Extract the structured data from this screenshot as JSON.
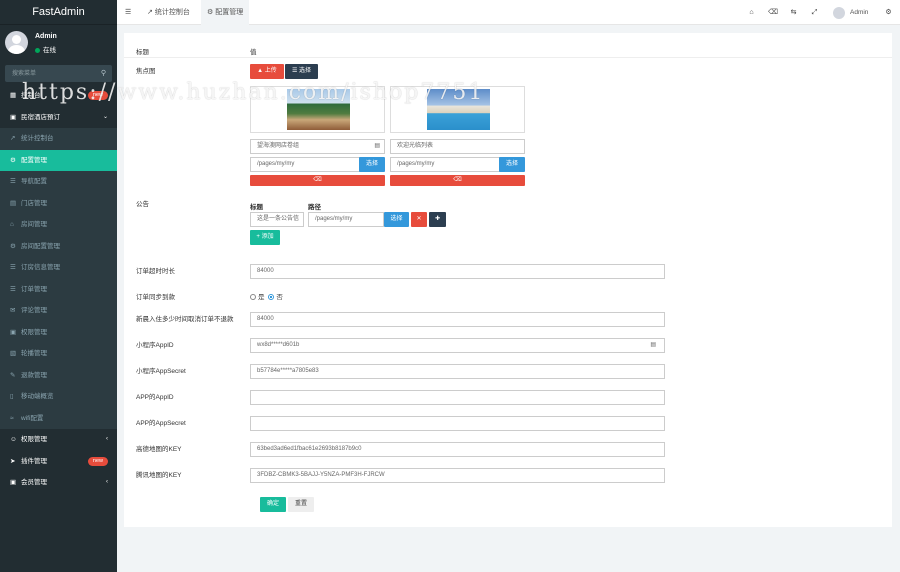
{
  "app": {
    "logo": "FastAdmin"
  },
  "user": {
    "name": "Admin",
    "status": "在线"
  },
  "sidebar": {
    "search_placeholder": "搜索菜单",
    "items": [
      {
        "label": "控制台",
        "icon": "dashboard-icon",
        "type": "top",
        "badge": "new"
      },
      {
        "label": "民宿酒店預订",
        "icon": "hotel-icon",
        "type": "top",
        "arrow": "open"
      },
      {
        "label": "统计控制台",
        "icon": "chart-icon",
        "type": "sub"
      },
      {
        "label": "配置管理",
        "icon": "gear-icon",
        "type": "sub",
        "active": true
      },
      {
        "label": "导航配置",
        "icon": "nav-icon",
        "type": "sub"
      },
      {
        "label": "门店管理",
        "icon": "store-icon",
        "type": "sub"
      },
      {
        "label": "房间管理",
        "icon": "home-icon",
        "type": "sub"
      },
      {
        "label": "房间配置管理",
        "icon": "settings-icon",
        "type": "sub"
      },
      {
        "label": "订房信息管理",
        "icon": "list-icon",
        "type": "sub"
      },
      {
        "label": "订单管理",
        "icon": "order-icon",
        "type": "sub"
      },
      {
        "label": "评论管理",
        "icon": "comment-icon",
        "type": "sub"
      },
      {
        "label": "权限管理",
        "icon": "lock-icon",
        "type": "sub"
      },
      {
        "label": "轮播管理",
        "icon": "image-icon",
        "type": "sub"
      },
      {
        "label": "退款管理",
        "icon": "refund-icon",
        "type": "sub"
      },
      {
        "label": "移动端概览",
        "icon": "mobile-icon",
        "type": "sub"
      },
      {
        "label": "wifi配置",
        "icon": "wifi-icon",
        "type": "sub"
      },
      {
        "label": "权限管理",
        "icon": "users-icon",
        "type": "top",
        "arrow": "closed"
      },
      {
        "label": "插件管理",
        "icon": "rocket-icon",
        "type": "top",
        "badge": "new"
      },
      {
        "label": "会员管理",
        "icon": "member-icon",
        "type": "top",
        "arrow": "closed"
      }
    ]
  },
  "header": {
    "menu_icon": "☰",
    "tabs": [
      {
        "label": "统计控制台",
        "icon": "chart-icon"
      },
      {
        "label": "配置管理",
        "icon": "gear-icon",
        "active": true
      }
    ],
    "user": "Admin"
  },
  "form": {
    "col_title": "标题",
    "col_value": "值",
    "focus_label": "焦点图",
    "upload_label": "上传",
    "choose_label": "选择",
    "slides": [
      {
        "title": "望海澳网店卷组",
        "path": "/pages/my/my",
        "choose": "选择"
      },
      {
        "title": "欢迎光临列表",
        "path": "/pages/my/my",
        "choose": "选择"
      }
    ],
    "notice_label": "公告",
    "notice_head_title": "标题",
    "notice_head_path": "路径",
    "notice_row": {
      "title": "这是一条公告信",
      "path": "/pages/my/my",
      "choose": "选择"
    },
    "add_label": "添加",
    "fields": [
      {
        "label": "订单超时时长",
        "value": "84000"
      },
      {
        "label": "订单同步到款",
        "radio": true,
        "yes": "是",
        "no": "否"
      },
      {
        "label": "新晨入住多少时间取消订单不退款",
        "value": "84000"
      },
      {
        "label": "小程序AppID",
        "value": "wx8d*****d601b",
        "icon": true
      },
      {
        "label": "小程序AppSecret",
        "value": "b57784e*****a7805e83"
      },
      {
        "label": "APP的AppID",
        "value": ""
      },
      {
        "label": "APP的AppSecret",
        "value": ""
      },
      {
        "label": "高德地图的KEY",
        "value": "63bed3ad6ed1fbac61e2693b8187b9c0"
      },
      {
        "label": "腾讯地图的KEY",
        "value": "3FDBZ-CBMK3-5BAJJ-Y5NZA-PMF3H-FJRCW"
      }
    ],
    "ok_label": "确定",
    "reset_label": "重置"
  },
  "watermark": "https://www.huzhan.com/ishop7751",
  "colors": {
    "primary": "#18bc9c",
    "danger": "#e74c3c",
    "dark": "#2c3e50",
    "info": "#3498db",
    "sidebar": "#222d32"
  }
}
